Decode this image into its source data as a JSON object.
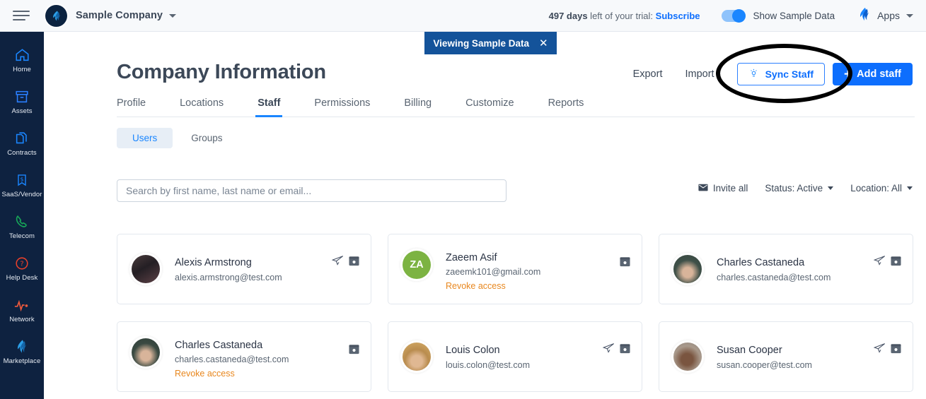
{
  "topbar": {
    "menu_icon": "hamburger-icon",
    "logo_icon": "company-logo-icon",
    "company_name": "Sample Company",
    "company_caret": "chevron-down-icon",
    "trial_days": "497 days",
    "trial_text": " left of your trial: ",
    "subscribe_label": "Subscribe",
    "sample_toggle_label": "Show Sample Data",
    "apps_label": "Apps",
    "apps_icon": "apps-logo-icon"
  },
  "sidebar": {
    "items": [
      {
        "label": "Home",
        "icon": "home-icon",
        "color": "#1a86ff"
      },
      {
        "label": "Assets",
        "icon": "assets-box-icon",
        "color": "#2b7fff"
      },
      {
        "label": "Contracts",
        "icon": "contracts-document-icon",
        "color": "#1a86ff"
      },
      {
        "label": "SaaS/Vendor",
        "icon": "saas-vendor-dollar-icon",
        "color": "#1a86ff"
      },
      {
        "label": "Telecom",
        "icon": "telecom-phone-icon",
        "color": "#17a558"
      },
      {
        "label": "Help Desk",
        "icon": "help-desk-question-icon",
        "color": "#e8402a"
      },
      {
        "label": "Network",
        "icon": "network-pulse-icon",
        "color": "#f05a3c"
      },
      {
        "label": "Marketplace",
        "icon": "marketplace-flame-icon",
        "color": "#1a86ff"
      }
    ]
  },
  "sample_banner": {
    "label": "Viewing Sample Data",
    "close_icon": "close-icon"
  },
  "page": {
    "title": "Company Information",
    "export_label": "Export",
    "import_label": "Import",
    "sync_label": "Sync Staff",
    "sync_icon": "lightbulb-idea-icon",
    "add_label": "Add staff",
    "add_icon": "plus-icon",
    "accent_color": "#0d6efd"
  },
  "tabs": [
    {
      "label": "Profile",
      "active": false
    },
    {
      "label": "Locations",
      "active": false
    },
    {
      "label": "Staff",
      "active": true
    },
    {
      "label": "Permissions",
      "active": false
    },
    {
      "label": "Billing",
      "active": false
    },
    {
      "label": "Customize",
      "active": false
    },
    {
      "label": "Reports",
      "active": false
    }
  ],
  "subtabs": [
    {
      "label": "Users",
      "active": true
    },
    {
      "label": "Groups",
      "active": false
    }
  ],
  "search": {
    "placeholder": "Search by first name, last name or email...",
    "value": ""
  },
  "filters": {
    "invite_all_label": "Invite all",
    "invite_all_icon": "envelope-icon",
    "status_label": "Status: Active",
    "location_label": "Location: All"
  },
  "users": [
    {
      "name": "Alexis Armstrong",
      "email": "alexis.armstrong@test.com",
      "revoke": "",
      "avatar_type": "photo",
      "avatar_bg": "#2b2a2e",
      "initials": "",
      "actions": [
        "send-invite-icon",
        "archive-icon"
      ],
      "layout": "compact"
    },
    {
      "name": "Zaeem Asif",
      "email": "zaeemk101@gmail.com",
      "revoke": "Revoke access",
      "avatar_type": "initials",
      "avatar_bg": "#7cb342",
      "initials": "ZA",
      "actions": [
        "archive-icon"
      ],
      "layout": "top"
    },
    {
      "name": "Charles Castaneda",
      "email": "charles.castaneda@test.com",
      "revoke": "",
      "avatar_type": "photo",
      "avatar_bg": "#4b5b52",
      "initials": "",
      "actions": [
        "send-invite-icon",
        "archive-icon"
      ],
      "layout": "compact"
    },
    {
      "name": "Charles Castaneda",
      "email": "charles.castaneda@test.com",
      "revoke": "Revoke access",
      "avatar_type": "photo",
      "avatar_bg": "#3d4a43",
      "initials": "",
      "actions": [
        "archive-icon"
      ],
      "layout": "top"
    },
    {
      "name": "Louis Colon",
      "email": "louis.colon@test.com",
      "revoke": "",
      "avatar_type": "photo",
      "avatar_bg": "#c9a469",
      "initials": "",
      "actions": [
        "send-invite-icon",
        "archive-icon"
      ],
      "layout": "compact"
    },
    {
      "name": "Susan Cooper",
      "email": "susan.cooper@test.com",
      "revoke": "",
      "avatar_type": "photo",
      "avatar_bg": "#8a7a6d",
      "initials": "",
      "actions": [
        "send-invite-icon",
        "archive-icon"
      ],
      "layout": "compact"
    }
  ],
  "annotation": {
    "shape": "ellipse-highlight",
    "color": "#000000"
  }
}
